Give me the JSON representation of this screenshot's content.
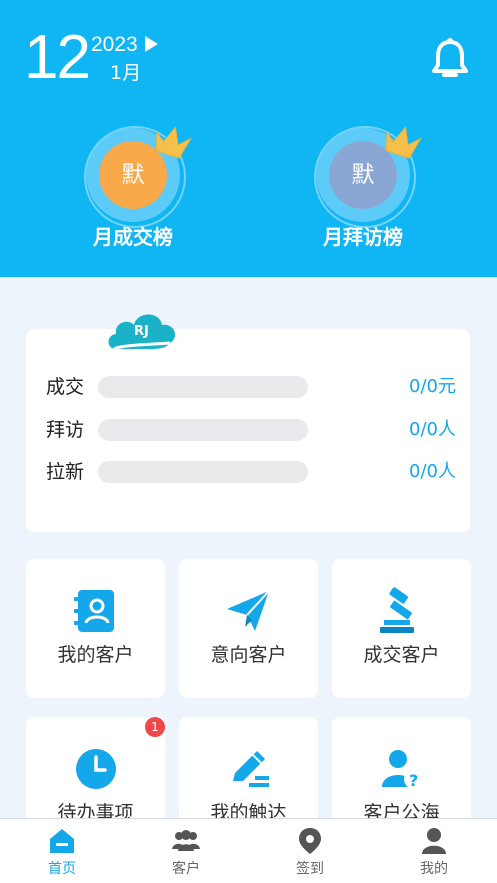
{
  "header": {
    "day": "12",
    "year": "2023",
    "month": "1月"
  },
  "ranks": [
    {
      "avatar_text": "默",
      "label": "月成交榜",
      "avatar_color": "#f9a84a"
    },
    {
      "avatar_text": "默",
      "label": "月拜访榜",
      "avatar_color": "#8aa6d4"
    }
  ],
  "stats": [
    {
      "name": "成交",
      "value": "0/0元"
    },
    {
      "name": "拜访",
      "value": "0/0人"
    },
    {
      "name": "拉新",
      "value": "0/0人"
    }
  ],
  "tiles": [
    {
      "label": "我的客户",
      "icon": "contact-book-icon"
    },
    {
      "label": "意向客户",
      "icon": "paper-plane-icon"
    },
    {
      "label": "成交客户",
      "icon": "gavel-icon"
    },
    {
      "label": "待办事项",
      "icon": "clock-icon",
      "badge": "1"
    },
    {
      "label": "我的触达",
      "icon": "pen-write-icon"
    },
    {
      "label": "客户公海",
      "icon": "user-question-icon"
    }
  ],
  "tabbar": {
    "items": [
      {
        "label": "首页",
        "icon": "home-icon",
        "active": true
      },
      {
        "label": "客户",
        "icon": "users-icon",
        "active": false
      },
      {
        "label": "签到",
        "icon": "location-pin-icon",
        "active": false
      },
      {
        "label": "我的",
        "icon": "person-icon",
        "active": false
      }
    ]
  },
  "colors": {
    "header_bg": "#10b6f3",
    "accent": "#14a7ea",
    "badge": "#f04848",
    "crown": "#f7c04a"
  }
}
